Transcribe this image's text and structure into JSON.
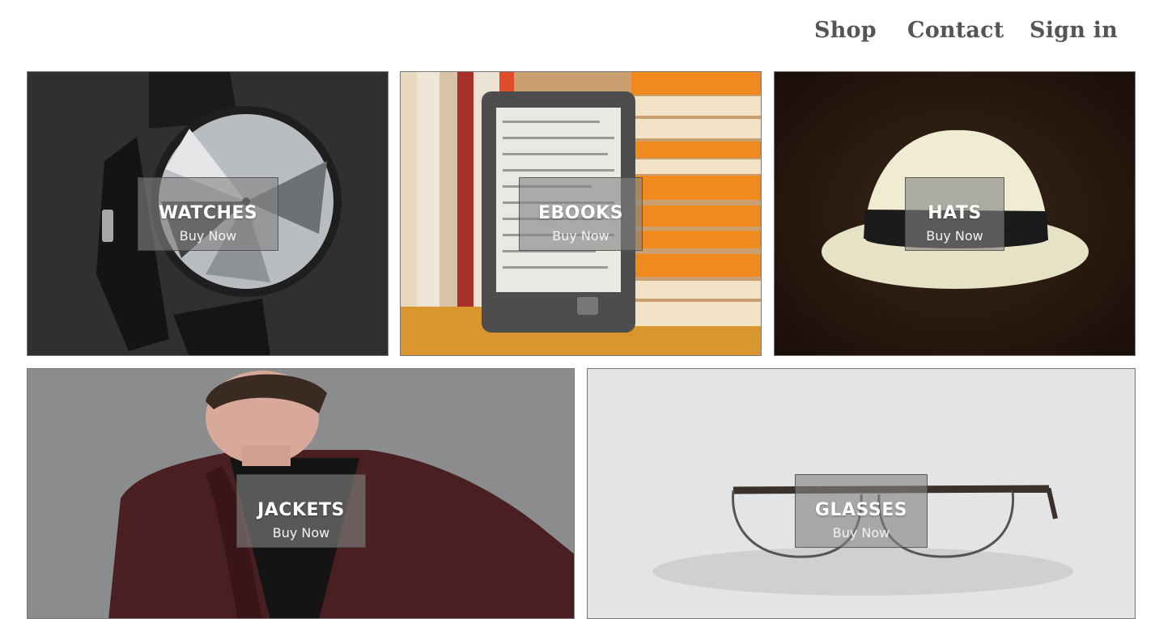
{
  "nav": {
    "shop": "Shop",
    "contact": "Contact",
    "sign_in": "Sign in"
  },
  "categories": [
    {
      "label": "WATCHES",
      "cta": "Buy Now"
    },
    {
      "label": "EBOOKS",
      "cta": "Buy Now"
    },
    {
      "label": "HATS",
      "cta": "Buy Now"
    },
    {
      "label": "JACKETS",
      "cta": "Buy Now"
    },
    {
      "label": "GLASSES",
      "cta": "Buy Now"
    }
  ],
  "colors": {
    "nav_text": "#555555",
    "overlay": "#828282",
    "overlay_text": "#ffffff"
  }
}
